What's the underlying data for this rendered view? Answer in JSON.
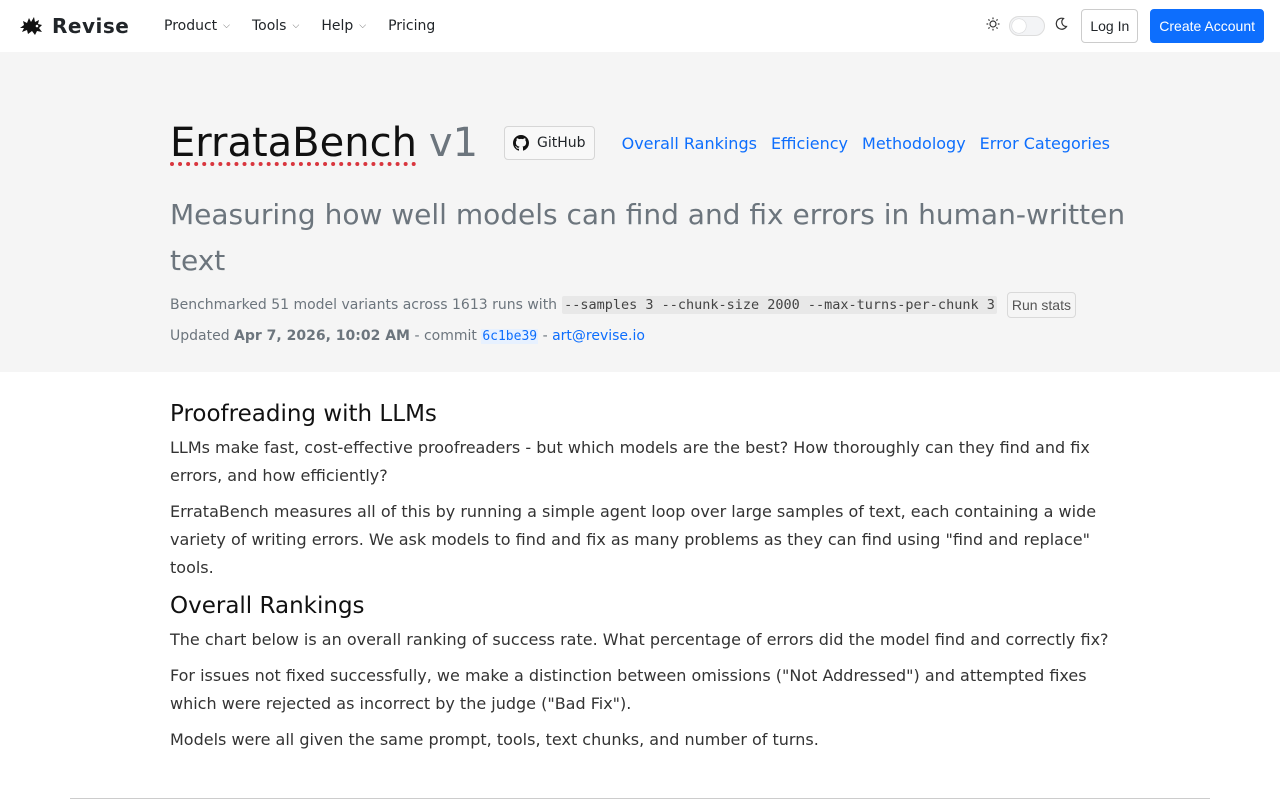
{
  "nav": {
    "brand": "Revise",
    "items": [
      {
        "label": "Product",
        "has_dropdown": true
      },
      {
        "label": "Tools",
        "has_dropdown": true
      },
      {
        "label": "Help",
        "has_dropdown": true
      },
      {
        "label": "Pricing",
        "has_dropdown": false
      }
    ],
    "theme": {
      "light_icon": "sun-icon",
      "dark_icon": "moon-icon",
      "dark_mode": false
    },
    "login_label": "Log In",
    "create_label": "Create Account",
    "accent": "#0d6efd"
  },
  "hero": {
    "title": "ErrataBench",
    "version": "v1",
    "github_label": "GitHub",
    "links": [
      "Overall Rankings",
      "Efficiency",
      "Methodology",
      "Error Categories"
    ],
    "subtitle": "Measuring how well models can find and fix errors in human-written text",
    "meta_prefix": "Benchmarked 51 model variants across 1613 runs with",
    "meta_code": "--samples 3 --chunk-size 2000 --max-turns-per-chunk 3",
    "run_stats_label": "Run stats",
    "updated_prefix": "Updated",
    "updated_date": "Apr 7, 2026, 10:02 AM",
    "commit_prefix": "- commit",
    "commit_hash": "6c1be39",
    "separator": "-",
    "email": "art@revise.io"
  },
  "content": {
    "section1_title": "Proofreading with LLMs",
    "section1_p1": "LLMs make fast, cost-effective proofreaders - but which models are the best? How thoroughly can they find and fix errors, and how efficiently?",
    "section1_p2": "ErrataBench measures all of this by running a simple agent loop over large samples of text, each containing a wide variety of writing errors. We ask models to find and fix as many problems as they can find using \"find and replace\" tools.",
    "section2_title": "Overall Rankings",
    "section2_p1": "The chart below is an overall ranking of success rate. What percentage of errors did the model find and correctly fix?",
    "section2_p2": "For issues not fixed successfully, we make a distinction between omissions (\"Not Addressed\") and attempted fixes which were rejected as incorrect by the judge (\"Bad Fix\").",
    "section2_p3": "Models were all given the same prompt, tools, text chunks, and number of turns."
  }
}
